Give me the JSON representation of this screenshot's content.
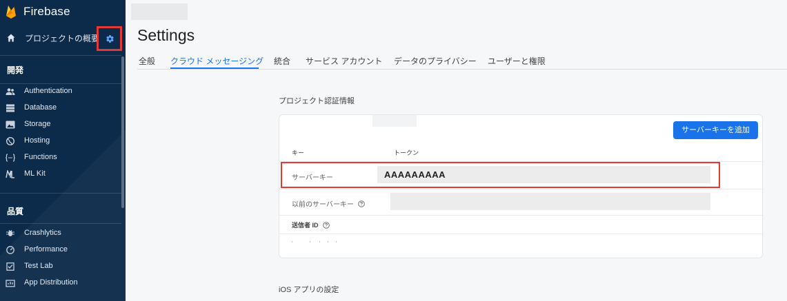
{
  "app": {
    "name": "Firebase",
    "brand_color": "#ffa000"
  },
  "sidebar": {
    "overview_label": "プロジェクトの概要",
    "overview_icon": "home-icon",
    "settings_icon": "gear-icon",
    "sections": [
      {
        "label": "開発",
        "items": [
          {
            "label": "Authentication",
            "icon": "people-icon"
          },
          {
            "label": "Database",
            "icon": "database-icon"
          },
          {
            "label": "Storage",
            "icon": "image-icon"
          },
          {
            "label": "Hosting",
            "icon": "globe-icon"
          },
          {
            "label": "Functions",
            "icon": "functions-icon"
          },
          {
            "label": "ML Kit",
            "icon": "ml-icon"
          }
        ]
      },
      {
        "label": "品質",
        "items": [
          {
            "label": "Crashlytics",
            "icon": "bug-icon"
          },
          {
            "label": "Performance",
            "icon": "speedometer-icon"
          },
          {
            "label": "Test Lab",
            "icon": "checklist-icon"
          },
          {
            "label": "App Distribution",
            "icon": "distribution-icon"
          }
        ]
      }
    ]
  },
  "page": {
    "title": "Settings",
    "tabs": [
      {
        "label": "全般",
        "active": false
      },
      {
        "label": "クラウド メッセージング",
        "active": true
      },
      {
        "label": "統合",
        "active": false
      },
      {
        "label": "サービス アカウント",
        "active": false
      },
      {
        "label": "データのプライバシー",
        "active": false
      },
      {
        "label": "ユーザーと権限",
        "active": false
      }
    ],
    "credentials": {
      "section_title": "プロジェクト認証情報",
      "add_button": "サーバーキーを追加",
      "col_key": "キー",
      "col_token": "トークン",
      "rows": [
        {
          "label": "サーバーキー",
          "token": "AAAAAAAAA"
        },
        {
          "label": "以前のサーバーキー",
          "token": ""
        },
        {
          "label": "送信者 ID",
          "token": ""
        }
      ]
    },
    "ios_section_title": "iOS アプリの設定"
  },
  "colors": {
    "sidebar_bg": "#0c2a4a",
    "accent": "#1a73e8",
    "highlight": "#e53935"
  }
}
